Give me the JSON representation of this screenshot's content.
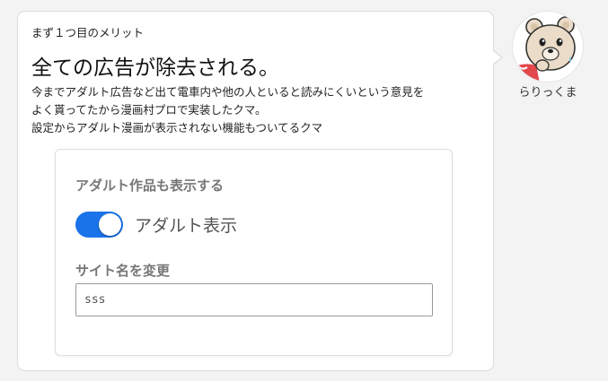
{
  "message": {
    "eyebrow": "まず１つ目のメリット",
    "headline": "全ての広告が除去される。",
    "body_lines": [
      "今までアダルト広告など出て電車内や他の人といると読みにくいという意見を",
      "よく貰ってたから漫画村プロで実装したクマ。",
      "設定からアダルト漫画が表示されない機能もついてるクマ"
    ]
  },
  "settings": {
    "adult_section_label": "アダルト作品も表示する",
    "adult_toggle_label": "アダルト表示",
    "adult_toggle_on": true,
    "site_name_section_label": "サイト名を変更",
    "site_name_value": "sss"
  },
  "author": {
    "name": "らりっくま",
    "avatar_icon": "bear-avatar-icon"
  },
  "colors": {
    "toggle_on": "#1a73e8",
    "background": "#f3f3f3",
    "label_gray": "#777777"
  }
}
